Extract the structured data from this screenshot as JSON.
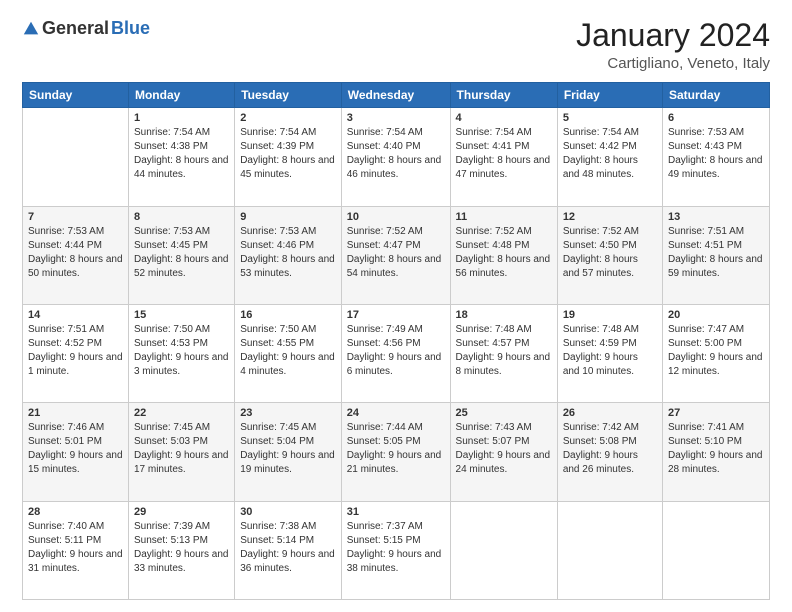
{
  "logo": {
    "general": "General",
    "blue": "Blue"
  },
  "header": {
    "month": "January 2024",
    "location": "Cartigliano, Veneto, Italy"
  },
  "days_of_week": [
    "Sunday",
    "Monday",
    "Tuesday",
    "Wednesday",
    "Thursday",
    "Friday",
    "Saturday"
  ],
  "weeks": [
    [
      {
        "day": "",
        "sunrise": "",
        "sunset": "",
        "daylight": ""
      },
      {
        "day": "1",
        "sunrise": "Sunrise: 7:54 AM",
        "sunset": "Sunset: 4:38 PM",
        "daylight": "Daylight: 8 hours and 44 minutes."
      },
      {
        "day": "2",
        "sunrise": "Sunrise: 7:54 AM",
        "sunset": "Sunset: 4:39 PM",
        "daylight": "Daylight: 8 hours and 45 minutes."
      },
      {
        "day": "3",
        "sunrise": "Sunrise: 7:54 AM",
        "sunset": "Sunset: 4:40 PM",
        "daylight": "Daylight: 8 hours and 46 minutes."
      },
      {
        "day": "4",
        "sunrise": "Sunrise: 7:54 AM",
        "sunset": "Sunset: 4:41 PM",
        "daylight": "Daylight: 8 hours and 47 minutes."
      },
      {
        "day": "5",
        "sunrise": "Sunrise: 7:54 AM",
        "sunset": "Sunset: 4:42 PM",
        "daylight": "Daylight: 8 hours and 48 minutes."
      },
      {
        "day": "6",
        "sunrise": "Sunrise: 7:53 AM",
        "sunset": "Sunset: 4:43 PM",
        "daylight": "Daylight: 8 hours and 49 minutes."
      }
    ],
    [
      {
        "day": "7",
        "sunrise": "Sunrise: 7:53 AM",
        "sunset": "Sunset: 4:44 PM",
        "daylight": "Daylight: 8 hours and 50 minutes."
      },
      {
        "day": "8",
        "sunrise": "Sunrise: 7:53 AM",
        "sunset": "Sunset: 4:45 PM",
        "daylight": "Daylight: 8 hours and 52 minutes."
      },
      {
        "day": "9",
        "sunrise": "Sunrise: 7:53 AM",
        "sunset": "Sunset: 4:46 PM",
        "daylight": "Daylight: 8 hours and 53 minutes."
      },
      {
        "day": "10",
        "sunrise": "Sunrise: 7:52 AM",
        "sunset": "Sunset: 4:47 PM",
        "daylight": "Daylight: 8 hours and 54 minutes."
      },
      {
        "day": "11",
        "sunrise": "Sunrise: 7:52 AM",
        "sunset": "Sunset: 4:48 PM",
        "daylight": "Daylight: 8 hours and 56 minutes."
      },
      {
        "day": "12",
        "sunrise": "Sunrise: 7:52 AM",
        "sunset": "Sunset: 4:50 PM",
        "daylight": "Daylight: 8 hours and 57 minutes."
      },
      {
        "day": "13",
        "sunrise": "Sunrise: 7:51 AM",
        "sunset": "Sunset: 4:51 PM",
        "daylight": "Daylight: 8 hours and 59 minutes."
      }
    ],
    [
      {
        "day": "14",
        "sunrise": "Sunrise: 7:51 AM",
        "sunset": "Sunset: 4:52 PM",
        "daylight": "Daylight: 9 hours and 1 minute."
      },
      {
        "day": "15",
        "sunrise": "Sunrise: 7:50 AM",
        "sunset": "Sunset: 4:53 PM",
        "daylight": "Daylight: 9 hours and 3 minutes."
      },
      {
        "day": "16",
        "sunrise": "Sunrise: 7:50 AM",
        "sunset": "Sunset: 4:55 PM",
        "daylight": "Daylight: 9 hours and 4 minutes."
      },
      {
        "day": "17",
        "sunrise": "Sunrise: 7:49 AM",
        "sunset": "Sunset: 4:56 PM",
        "daylight": "Daylight: 9 hours and 6 minutes."
      },
      {
        "day": "18",
        "sunrise": "Sunrise: 7:48 AM",
        "sunset": "Sunset: 4:57 PM",
        "daylight": "Daylight: 9 hours and 8 minutes."
      },
      {
        "day": "19",
        "sunrise": "Sunrise: 7:48 AM",
        "sunset": "Sunset: 4:59 PM",
        "daylight": "Daylight: 9 hours and 10 minutes."
      },
      {
        "day": "20",
        "sunrise": "Sunrise: 7:47 AM",
        "sunset": "Sunset: 5:00 PM",
        "daylight": "Daylight: 9 hours and 12 minutes."
      }
    ],
    [
      {
        "day": "21",
        "sunrise": "Sunrise: 7:46 AM",
        "sunset": "Sunset: 5:01 PM",
        "daylight": "Daylight: 9 hours and 15 minutes."
      },
      {
        "day": "22",
        "sunrise": "Sunrise: 7:45 AM",
        "sunset": "Sunset: 5:03 PM",
        "daylight": "Daylight: 9 hours and 17 minutes."
      },
      {
        "day": "23",
        "sunrise": "Sunrise: 7:45 AM",
        "sunset": "Sunset: 5:04 PM",
        "daylight": "Daylight: 9 hours and 19 minutes."
      },
      {
        "day": "24",
        "sunrise": "Sunrise: 7:44 AM",
        "sunset": "Sunset: 5:05 PM",
        "daylight": "Daylight: 9 hours and 21 minutes."
      },
      {
        "day": "25",
        "sunrise": "Sunrise: 7:43 AM",
        "sunset": "Sunset: 5:07 PM",
        "daylight": "Daylight: 9 hours and 24 minutes."
      },
      {
        "day": "26",
        "sunrise": "Sunrise: 7:42 AM",
        "sunset": "Sunset: 5:08 PM",
        "daylight": "Daylight: 9 hours and 26 minutes."
      },
      {
        "day": "27",
        "sunrise": "Sunrise: 7:41 AM",
        "sunset": "Sunset: 5:10 PM",
        "daylight": "Daylight: 9 hours and 28 minutes."
      }
    ],
    [
      {
        "day": "28",
        "sunrise": "Sunrise: 7:40 AM",
        "sunset": "Sunset: 5:11 PM",
        "daylight": "Daylight: 9 hours and 31 minutes."
      },
      {
        "day": "29",
        "sunrise": "Sunrise: 7:39 AM",
        "sunset": "Sunset: 5:13 PM",
        "daylight": "Daylight: 9 hours and 33 minutes."
      },
      {
        "day": "30",
        "sunrise": "Sunrise: 7:38 AM",
        "sunset": "Sunset: 5:14 PM",
        "daylight": "Daylight: 9 hours and 36 minutes."
      },
      {
        "day": "31",
        "sunrise": "Sunrise: 7:37 AM",
        "sunset": "Sunset: 5:15 PM",
        "daylight": "Daylight: 9 hours and 38 minutes."
      },
      {
        "day": "",
        "sunrise": "",
        "sunset": "",
        "daylight": ""
      },
      {
        "day": "",
        "sunrise": "",
        "sunset": "",
        "daylight": ""
      },
      {
        "day": "",
        "sunrise": "",
        "sunset": "",
        "daylight": ""
      }
    ]
  ]
}
